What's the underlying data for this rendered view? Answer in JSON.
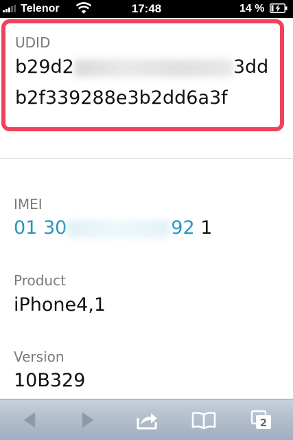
{
  "status_bar": {
    "carrier": "Telenor",
    "time": "17:48",
    "battery": "14 %",
    "signal_icon": "signal-bars-icon",
    "wifi_icon": "wifi-icon",
    "battery_icon": "battery-charging-icon"
  },
  "udid": {
    "label": "UDID",
    "line1_start": "b29d2",
    "line1_end": "3dd",
    "line2": "b2f339288e3b2dd6a3f",
    "highlight_color": "#f0425b"
  },
  "imei": {
    "label": "IMEI",
    "prefix": "01 30",
    "suffix": "92",
    "last_digit": "1",
    "link_color": "#2a93bb"
  },
  "product": {
    "label": "Product",
    "value": "iPhone4,1"
  },
  "version": {
    "label": "Version",
    "value": "10B329"
  },
  "toolbar": {
    "back_icon": "back-arrow-icon",
    "forward_icon": "forward-arrow-icon",
    "share_icon": "share-icon",
    "bookmarks_icon": "bookmarks-icon",
    "tabs_icon": "tabs-icon",
    "tab_count": "2"
  }
}
